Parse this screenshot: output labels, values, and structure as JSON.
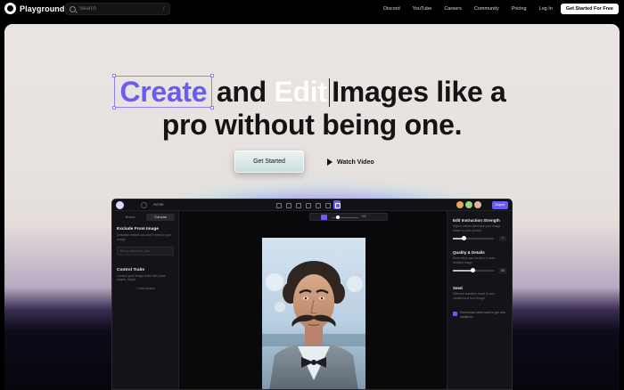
{
  "nav": {
    "brand": "Playground",
    "search_placeholder": "Search",
    "search_shortcut": "/",
    "links": [
      "Discord",
      "YouTube",
      "Careers",
      "Community",
      "Pricing",
      "Log In"
    ],
    "cta": "Get Started For Free"
  },
  "hero": {
    "headline_word1": "Create",
    "headline_and": "and",
    "headline_word2": "Edit",
    "headline_rest1": "Images like a",
    "headline_line2": "pro without being one.",
    "primary_button": "Get Started",
    "secondary_button": "Watch Video"
  },
  "app": {
    "name": "Acme",
    "cta": "Export",
    "left_tabs": [
      "Board",
      "Canvas"
    ],
    "exclude_title": "Exclude From Image",
    "exclude_desc": "Describe details you don't want in your image",
    "exclude_placeholder": "Blurry, distorted, low...",
    "control_title": "Control Traits",
    "control_desc": "Control your image traits like pose, edges, depth",
    "add_control": "+ Add control",
    "zoom_value": "100",
    "strength_title": "Edit Instruction Strength",
    "strength_desc": "Higher values will make your image closer to your prompt",
    "strength_value": "7",
    "quality_title": "Quality & Details",
    "quality_desc": "More steps can result in a more detailed image",
    "quality_value": "50",
    "seed_title": "Seed",
    "seed_desc": "Different numbers result in new variations of your image",
    "randomize_text": "Randomize seed value to get new variations"
  },
  "colors": {
    "accent": "#6a5cf0",
    "headline": "#141414",
    "background": "#000000"
  }
}
